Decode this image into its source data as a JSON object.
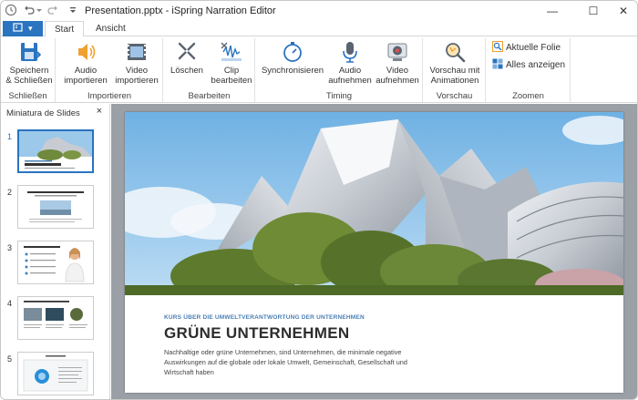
{
  "window": {
    "title": "Presentation.pptx - iSpring Narration Editor",
    "icons": [
      "app-icon",
      "undo-icon",
      "dropdown-icon",
      "redo-icon",
      "customize-icon"
    ],
    "controls": [
      "minimize-icon",
      "maximize-icon",
      "close-icon"
    ]
  },
  "tabs": [
    {
      "label": "Start",
      "active": true
    },
    {
      "label": "Ansicht",
      "active": false
    }
  ],
  "ribbon": {
    "groups": [
      {
        "label": "Schließen",
        "buttons": [
          {
            "label": "Speichern\n& Schließen",
            "icon": "save-close-icon"
          }
        ]
      },
      {
        "label": "Importieren",
        "buttons": [
          {
            "label": "Audio\nimportieren",
            "icon": "audio-import-icon"
          },
          {
            "label": "Video\nimportieren",
            "icon": "video-import-icon"
          }
        ]
      },
      {
        "label": "Bearbeiten",
        "buttons": [
          {
            "label": "Löschen",
            "icon": "scissors-icon"
          },
          {
            "label": "Clip\nbearbeiten",
            "icon": "clip-edit-icon"
          }
        ]
      },
      {
        "label": "Timing",
        "buttons": [
          {
            "label": "Synchronisieren",
            "icon": "stopwatch-icon"
          },
          {
            "label": "Audio\naufnehmen",
            "icon": "microphone-icon"
          },
          {
            "label": "Video\naufnehmen",
            "icon": "webcam-icon"
          }
        ]
      },
      {
        "label": "Vorschau",
        "buttons": [
          {
            "label": "Vorschau mit\nAnimationen",
            "icon": "preview-magnifier-icon"
          }
        ]
      },
      {
        "label": "Zoomen",
        "small_buttons": [
          {
            "label": "Aktuelle Folie",
            "icon": "zoom-slide-icon"
          },
          {
            "label": "Alles anzeigen",
            "icon": "show-all-icon"
          }
        ]
      }
    ]
  },
  "thumbnails_panel": {
    "title": "Miniatura de Slides",
    "close": "×",
    "slides": [
      {
        "number": "1",
        "selected": true
      },
      {
        "number": "2",
        "selected": false
      },
      {
        "number": "3",
        "selected": false
      },
      {
        "number": "4",
        "selected": false
      },
      {
        "number": "5",
        "selected": false
      }
    ]
  },
  "slide": {
    "kicker": "KURS ÜBER DIE UMWELTVERANTWORTUNG DER UNTERNEHMEN",
    "headline": "GRÜNE UNTERNEHMEN",
    "body": "Nachhaltige oder grüne Unternehmen, sind Unternehmen, die minimale negative Auswirkungen auf die globale oder lokale Umwelt, Gemeinschaft, Gesellschaft und Wirtschaft haben"
  },
  "colors": {
    "accent": "#2a74c0",
    "stage": "#9aa0a6",
    "icon_orange": "#f0a030"
  }
}
